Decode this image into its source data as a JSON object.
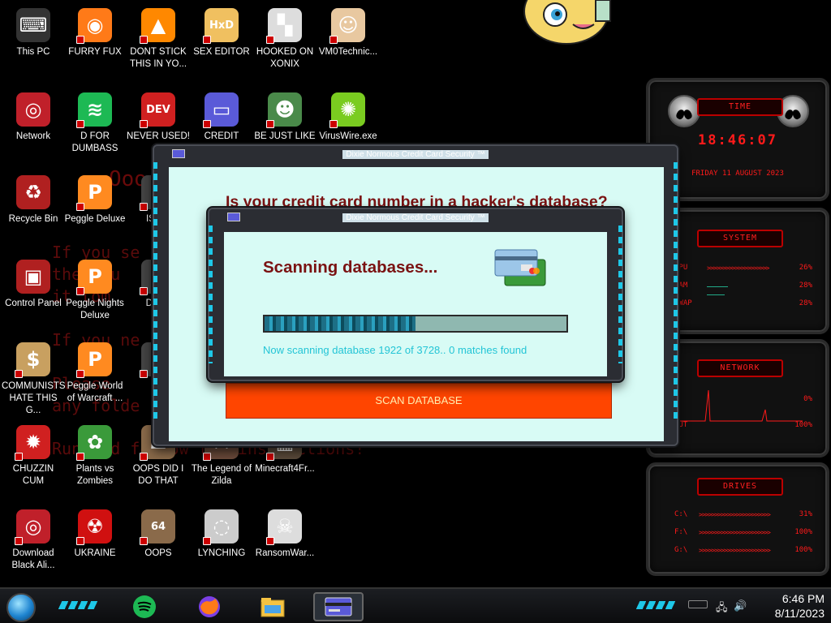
{
  "wallpaper": {
    "lines": [
      "If you se",
      "the you",
      "it tom",
      "If you ne",
      "Please",
      "any folde",
      "Run and follow the instructions!"
    ],
    "big": "Ooo"
  },
  "desktop_icons": [
    {
      "label": "This PC",
      "icon": "pc-icon"
    },
    {
      "label": "FURRY FUX",
      "icon": "firefox-icon"
    },
    {
      "label": "DONT STICK THIS IN YO...",
      "icon": "vlc-cone-icon"
    },
    {
      "label": "SEX EDITOR",
      "icon": "hxd-editor-icon"
    },
    {
      "label": "HOOKED ON XONIX",
      "icon": "xonix-icon"
    },
    {
      "label": "VM0Technic...",
      "icon": "doctor-icon"
    },
    {
      "label": "Network",
      "icon": "alien-network-icon"
    },
    {
      "label": "D FOR DUMBASS",
      "icon": "spotify-icon"
    },
    {
      "label": "NEVER USED!",
      "icon": "dev-cpp-icon"
    },
    {
      "label": "CREDIT CARD",
      "icon": "credit-card-icon"
    },
    {
      "label": "BE JUST LIKE",
      "icon": "elf-icon"
    },
    {
      "label": "VirusWire.exe",
      "icon": "lime-icon"
    },
    {
      "label": "Recycle Bin",
      "icon": "recycle-bin-icon"
    },
    {
      "label": "Peggle Deluxe",
      "icon": "peggle-icon"
    },
    {
      "label": "ISRAI",
      "icon": "unknown-icon"
    },
    {
      "label": "Control Panel",
      "icon": "control-panel-icon"
    },
    {
      "label": "Peggle Nights Deluxe",
      "icon": "peggle-nights-icon"
    },
    {
      "label": "DEEZ",
      "icon": "unknown-icon"
    },
    {
      "label": "COMMUNISTS HATE THIS G...",
      "icon": "money-bag-icon"
    },
    {
      "label": "Peggle World of Warcraft ...",
      "icon": "peggle-wow-icon"
    },
    {
      "label": "DIE",
      "icon": "unknown-icon"
    },
    {
      "label": "CHUZZIN CUM",
      "icon": "chuzzle-icon"
    },
    {
      "label": "Plants vs Zombies",
      "icon": "pvz-flower-icon"
    },
    {
      "label": "OOPS DID I DO THAT",
      "icon": "portrait-icon"
    },
    {
      "label": "The Legend of Zilda",
      "icon": "zelda-icon"
    },
    {
      "label": "Minecraft4Fr...",
      "icon": "minecraft-icon"
    },
    {
      "label": "Download Black Ali...",
      "icon": "alien-download-icon"
    },
    {
      "label": "UKRAINE",
      "icon": "radiation-icon"
    },
    {
      "label": "OOPS",
      "icon": "portrait-64-icon"
    },
    {
      "label": "LYNCHING",
      "icon": "noose-icon"
    },
    {
      "label": "RansomWar...",
      "icon": "skull-icon"
    }
  ],
  "gadgets": {
    "time": {
      "title": "TIME",
      "clock": "18:46:07",
      "date": "FRIDAY 11 AUGUST 2023"
    },
    "system": {
      "title": "SYSTEM",
      "rows": [
        {
          "key": "CPU",
          "value": "26%"
        },
        {
          "key": "RAM",
          "value": "28%"
        },
        {
          "key": "SWAP",
          "value": "28%"
        }
      ]
    },
    "network": {
      "title": "NETWORK",
      "rows": [
        {
          "key": "IN",
          "value": "0%"
        },
        {
          "key": "OUT",
          "value": "100%"
        }
      ]
    },
    "drives": {
      "title": "DRIVES",
      "rows": [
        {
          "key": "C:\\",
          "value": "31%"
        },
        {
          "key": "F:\\",
          "value": "100%"
        },
        {
          "key": "G:\\",
          "value": "100%"
        }
      ]
    }
  },
  "back_dialog": {
    "title": "Dixie Normous Credit Card Security ™",
    "heading": "Is your credit card number in a hacker's database?",
    "button": "SCAN DATABASE"
  },
  "front_dialog": {
    "title": "Dixie Normous Credit Card Security ™",
    "heading": "Scanning databases...",
    "progress_fraction": 0.5,
    "status": "Now scanning database 1922 of 3728.. 0 matches found"
  },
  "taskbar": {
    "time": "6:46 PM",
    "date": "8/11/2023",
    "items": [
      "spotify-icon",
      "firefox-icon",
      "file-explorer-icon",
      "credit-card-app-icon"
    ]
  },
  "colors": {
    "accent_cyan": "#1ec8e8",
    "gadget_red": "#ff1a1a",
    "dialog_bg": "#d8fbf5",
    "heading_red": "#7a1212",
    "button_orange": "#ff4500"
  }
}
